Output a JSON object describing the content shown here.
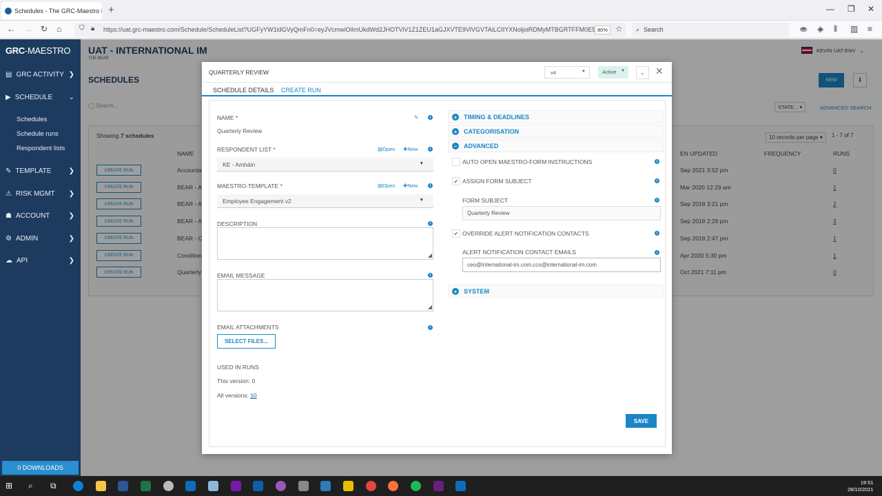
{
  "browser": {
    "tab_title": "Schedules - The GRC-Maestro P",
    "url": "https://uat.grc-maestro.com/Schedule/ScheduleList?UGFyYW1ldGVyQmFn0=eyJVcmwiOiImUkdWd2JHOTViV1Z1ZEU1aGJXVTE9VlVGVTAiLCIIYXNoljoiRDMyMTBGRTFFM0E5",
    "zoom": "80%",
    "search_placeholder": "Search"
  },
  "sidebar": {
    "logo_a": "GRC",
    "logo_b": "-MAESTRO",
    "items": [
      {
        "label": "GRC ACTIVITY",
        "icon": "chart-icon"
      },
      {
        "label": "SCHEDULE",
        "icon": "play-icon"
      },
      {
        "label": "TEMPLATE",
        "icon": "pencil-icon"
      },
      {
        "label": "RISK MGMT",
        "icon": "warning-icon"
      },
      {
        "label": "ACCOUNT",
        "icon": "users-icon"
      },
      {
        "label": "ADMIN",
        "icon": "gear-icon"
      },
      {
        "label": "API",
        "icon": "cloud-icon"
      }
    ],
    "sub_items": [
      "Schedules",
      "Schedule runs",
      "Respondent lists"
    ],
    "downloads": "0 DOWNLOADS"
  },
  "page": {
    "org": "UAT - INTERNATIONAL IM",
    "org_sub": "THE BEAR",
    "user": "KEVIN UAT-ENV",
    "heading": "SCHEDULES",
    "new_label": "NEW",
    "search_placeholder": "Search...",
    "state_label": "STATE...",
    "advanced_search": "ADVANCED SEARCH",
    "showing_prefix": "Showing ",
    "showing_count": "7 schedules",
    "records": "10 records per page",
    "pager": "1 - 7 of 7",
    "cols": {
      "name": "NAME",
      "updated": "EN UPDATED",
      "frequency": "FREQUENCY",
      "runs": "RUNS"
    },
    "rows": [
      {
        "action": "CREATE RUN",
        "name": "Accounta",
        "updated": "Sep 2021 3:52 pm",
        "runs": "0"
      },
      {
        "action": "CREATE RUN",
        "name": "BEAR - A",
        "updated": "Mar 2020 12:29 am",
        "runs": "1"
      },
      {
        "action": "CREATE RUN",
        "name": "BEAR - A",
        "updated": "Sep 2018 3:21 pm",
        "runs": "2"
      },
      {
        "action": "CREATE RUN",
        "name": "BEAR - A",
        "updated": "Sep 2018 2:29 pm",
        "runs": "3"
      },
      {
        "action": "CREATE RUN",
        "name": "BEAR - C",
        "updated": "Sep 2018 2:47 pm",
        "runs": "1"
      },
      {
        "action": "CREATE RUN",
        "name": "Condition",
        "updated": "Apr 2020 5:30 pm",
        "runs": "1"
      },
      {
        "action": "CREATE RUN",
        "name": "Quarterly",
        "updated": "Oct 2021 7:11 pm",
        "runs": "0"
      }
    ]
  },
  "modal": {
    "title": "QUARTERLY REVIEW",
    "version": "v4",
    "status": "Active",
    "tabs": [
      "SCHEDULE DETAILS",
      "CREATE RUN"
    ],
    "name_label": "NAME *",
    "name_value": "Quarterly Review",
    "respondent_label": "RESPONDENT LIST *",
    "respondent_value": "KE - Amháin",
    "template_label": "MAESTRO-TEMPLATE *",
    "template_value": "Employee Engagement v2",
    "open_label": "Open",
    "new_label": "New",
    "description_label": "DESCRIPTION",
    "email_message_label": "EMAIL MESSAGE",
    "attachments_label": "EMAIL ATTACHMENTS",
    "select_files": "SELECT FILES...",
    "used_in_runs": "USED IN RUNS",
    "this_version": "This version: 0",
    "all_versions_label": "All versions: ",
    "all_versions_value": "10",
    "sections": {
      "timing": "TIMING & DEADLINES",
      "categorisation": "CATEGORISATION",
      "advanced": "ADVANCED",
      "system": "SYSTEM"
    },
    "auto_open": "AUTO OPEN MAESTRO-FORM INSTRUCTIONS",
    "assign_subject": "ASSIGN FORM SUBJECT",
    "form_subject_label": "FORM SUBJECT",
    "form_subject_value": "Quarterly Review",
    "override_alert": "OVERRIDE ALERT NOTIFICATION CONTACTS",
    "alert_emails_label": "ALERT NOTIFICATION CONTACT EMAILS",
    "alert_emails_value": "ceo@international-im.com,cco@international-im.com",
    "save": "SAVE"
  },
  "taskbar": {
    "time": "19:51",
    "date": "28/10/2021"
  }
}
